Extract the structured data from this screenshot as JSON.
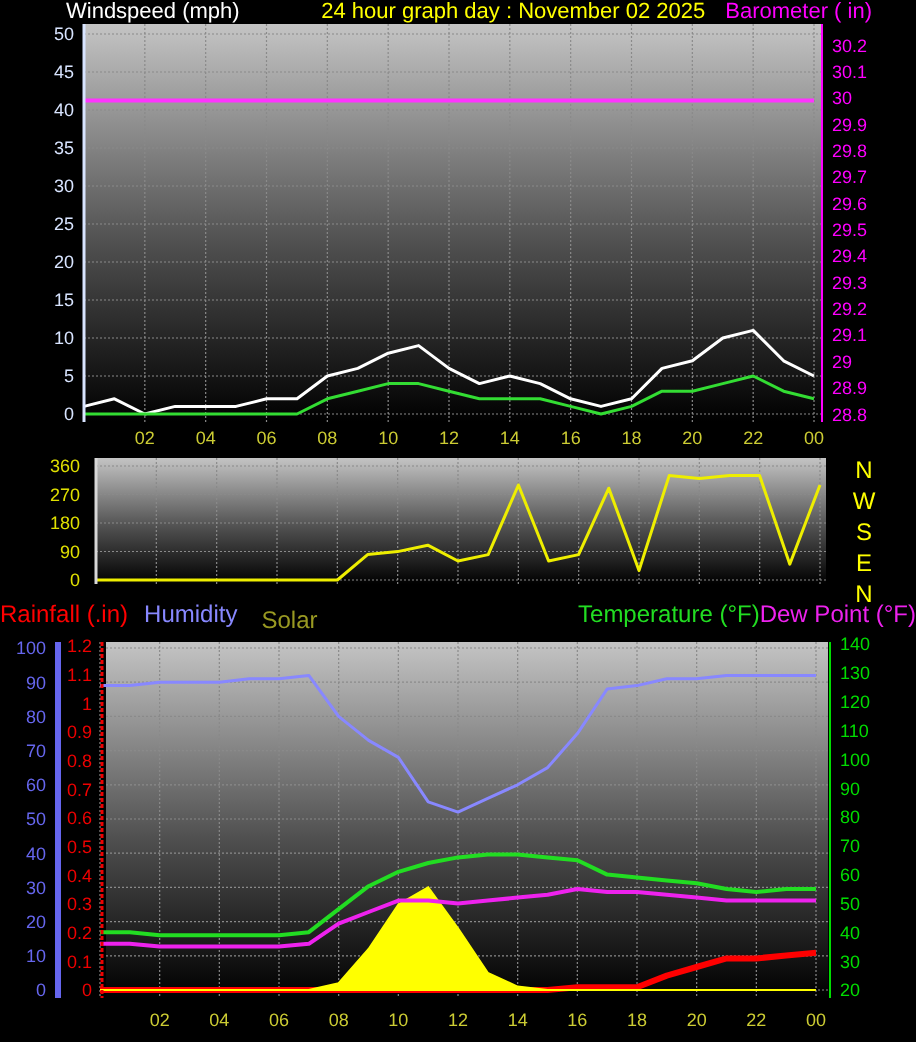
{
  "charts": [
    {
      "chart_data": {
        "type": "line",
        "title": "24 hour graph day : November 02 2025",
        "ylabel": "Windspeed (mph)",
        "y2label": "Barometer ( in)",
        "ylim": [
          0,
          50
        ],
        "yticks": [
          0,
          5,
          10,
          15,
          20,
          25,
          30,
          35,
          40,
          45,
          50
        ],
        "grid": true,
        "y2lim": [
          28.77,
          30.28
        ],
        "categories": [
          null,
          null,
          "02",
          null,
          "04",
          null,
          "06",
          null,
          "08",
          null,
          "10",
          null,
          "12",
          null,
          "14",
          null,
          "16",
          null,
          "18",
          null,
          "20",
          null,
          "22",
          null,
          "00"
        ],
        "y2ticks": [
          28.8,
          28.9,
          29,
          29.1,
          29.2,
          29.3,
          29.4,
          29.5,
          29.6,
          29.7,
          29.8,
          29.9,
          30,
          30.1,
          30.2
        ],
        "series": [
          {
            "color": "#ffffff",
            "values": [
              1,
              2,
              0,
              1,
              1,
              1,
              2,
              2,
              5,
              6,
              8,
              9,
              6,
              4,
              5,
              4,
              2,
              1,
              2,
              6,
              7,
              10,
              11,
              7,
              5
            ]
          },
          {
            "color": "#33dd33",
            "values": [
              0,
              0,
              0,
              0,
              0,
              0,
              0,
              0,
              2,
              3,
              4,
              4,
              3,
              2,
              2,
              2,
              1,
              0,
              1,
              3,
              3,
              4,
              5,
              3,
              2
            ]
          },
          {
            "axis": "y2",
            "color": "#ff33ff",
            "values": [
              29.99,
              29.99,
              29.99,
              29.99,
              29.99,
              29.99,
              29.99,
              29.99,
              29.99,
              29.99,
              29.99,
              29.99,
              29.99,
              29.99,
              29.99,
              29.99,
              29.99,
              29.99,
              29.99,
              29.99,
              29.99,
              29.99,
              29.99,
              29.99,
              29.99
            ]
          }
        ]
      }
    },
    {
      "chart_data": {
        "type": "line",
        "categories": [
          null,
          null,
          null,
          null,
          null,
          null,
          null,
          null,
          null,
          null,
          null,
          null,
          null,
          null,
          null,
          null,
          null,
          null,
          null,
          null,
          null,
          null,
          null,
          null,
          null
        ],
        "grid": true,
        "ylim": [
          -12.6,
          385.3
        ],
        "yticks": [
          0,
          90,
          180,
          270,
          360
        ],
        "series": [
          {
            "color": "#eeee00",
            "values": [
              0,
              0,
              0,
              0,
              0,
              0,
              0,
              0,
              0,
              80,
              90,
              110,
              60,
              80,
              300,
              60,
              80,
              290,
              30,
              330,
              320,
              330,
              330,
              50,
              300
            ]
          }
        ]
      },
      "compass_labels": [
        "N",
        "W",
        "S",
        "E",
        "N"
      ]
    },
    {
      "chart_data": {
        "type": "line",
        "categories": [
          null,
          null,
          "02",
          null,
          "04",
          null,
          "06",
          null,
          "08",
          null,
          "10",
          null,
          "12",
          null,
          "14",
          null,
          "16",
          null,
          "18",
          null,
          "20",
          null,
          "22",
          null,
          "00"
        ],
        "grid": true,
        "ylim": [
          0,
          100
        ],
        "yticks": [
          0,
          10,
          20,
          30,
          40,
          50,
          60,
          70,
          80,
          90,
          100
        ],
        "y2lim": [
          -0.028,
          1.214
        ],
        "y2ticks": [
          0,
          0.1,
          0.2,
          0.3,
          0.4,
          0.5,
          0.6,
          0.7,
          0.8,
          0.9,
          1,
          1.1,
          1.2
        ],
        "y3lim": [
          17.2,
          140.7
        ],
        "y3ticks": [
          20,
          30,
          40,
          50,
          60,
          70,
          80,
          90,
          100,
          110,
          120,
          130,
          140
        ],
        "series": [
          {
            "name": "Rainfall (.in)",
            "axis": "y2",
            "color": "#ff0000",
            "values": [
              0,
              0,
              0,
              0,
              0,
              0,
              0,
              0,
              0,
              0,
              0,
              0,
              0,
              0,
              0,
              0,
              0.01,
              0.01,
              0.01,
              0.05,
              0.08,
              0.11,
              0.11,
              0.12,
              0.13
            ]
          },
          {
            "name": "Humidity",
            "color": "#8888ff",
            "values": [
              89,
              89,
              90,
              90,
              90,
              91,
              91,
              92,
              80,
              73,
              68,
              55,
              52,
              56,
              60,
              65,
              75,
              88,
              89,
              91,
              91,
              92,
              92,
              92,
              92
            ]
          },
          {
            "name": "Solar",
            "type": "area",
            "color": "#ffff00",
            "values": [
              0,
              0,
              0,
              0,
              0,
              0,
              0,
              0,
              2,
              12,
              25,
              30,
              18,
              5,
              1,
              0,
              0,
              0,
              0,
              0,
              0,
              0,
              0,
              0,
              0
            ]
          },
          {
            "name": "Temperature (°F)",
            "axis": "y3",
            "color": "#22dd22",
            "values": [
              40,
              40,
              39,
              39,
              39,
              39,
              39,
              40,
              48,
              56,
              61,
              64,
              66,
              67,
              67,
              66,
              65,
              60,
              59,
              58,
              57,
              55,
              54,
              55,
              55
            ]
          },
          {
            "name": "Dew Point (°F)",
            "axis": "y3",
            "color": "#ee22ee",
            "values": [
              36,
              36,
              35,
              35,
              35,
              35,
              35,
              36,
              43,
              47,
              51,
              51,
              50,
              51,
              52,
              53,
              55,
              54,
              54,
              53,
              52,
              51,
              51,
              51,
              51
            ]
          }
        ]
      }
    }
  ]
}
